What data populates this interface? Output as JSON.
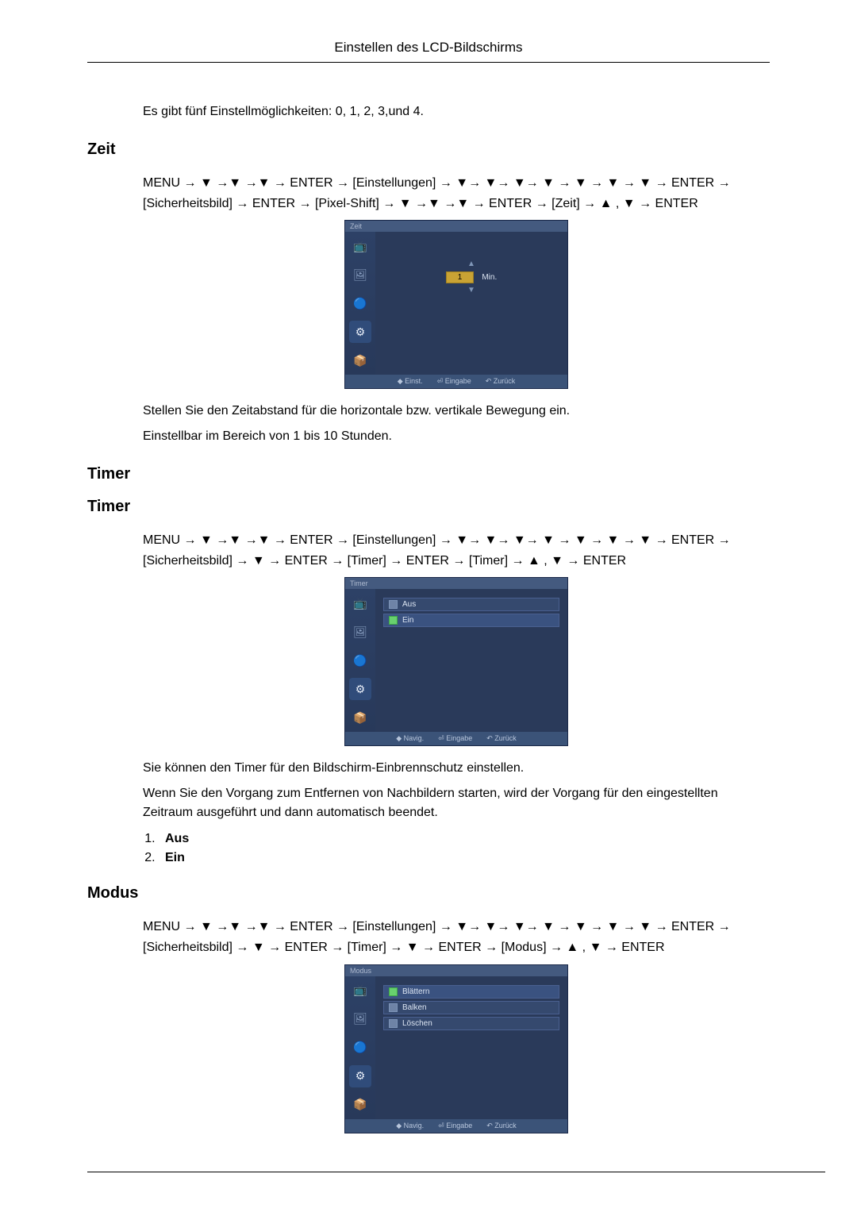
{
  "header": {
    "title": "Einstellen des LCD-Bildschirms"
  },
  "intro": "Es gibt fünf Einstellmöglichkeiten: 0, 1, 2, 3,und 4.",
  "sections": {
    "zeit": {
      "heading": "Zeit",
      "path": "MENU → ▼ →▼ →▼ → ENTER → [Einstellungen] → ▼→ ▼→ ▼→ ▼ → ▼ → ▼ → ▼ → ENTER → [Sicherheitsbild] → ENTER → [Pixel-Shift] → ▼ →▼ →▼ → ENTER → [Zeit] → ▲ , ▼ → ENTER",
      "osd_title": "Zeit",
      "osd_value": "1",
      "osd_unit": "Min.",
      "footer": {
        "a": "◆ Einst.",
        "b": "⏎ Eingabe",
        "c": "↶ Zurück"
      },
      "text1": "Stellen Sie den Zeitabstand für die horizontale bzw. vertikale Bewegung ein.",
      "text2": "Einstellbar im Bereich von 1 bis 10 Stunden."
    },
    "timer": {
      "heading1": "Timer",
      "heading2": "Timer",
      "path": "MENU → ▼ →▼ →▼ → ENTER → [Einstellungen] → ▼→ ▼→ ▼→ ▼ → ▼ → ▼ → ▼ → ENTER → [Sicherheitsbild] → ▼ → ENTER → [Timer] → ENTER → [Timer] → ▲ , ▼ → ENTER",
      "osd_title": "Timer",
      "options": {
        "off": "Aus",
        "on": "Ein"
      },
      "footer": {
        "a": "◆ Navig.",
        "b": "⏎ Eingabe",
        "c": "↶ Zurück"
      },
      "text1": "Sie können den Timer für den Bildschirm-Einbrennschutz einstellen.",
      "text2": "Wenn Sie den Vorgang zum Entfernen von Nachbildern starten, wird der Vorgang für den eingestellten Zeitraum ausgeführt und dann automatisch beendet.",
      "list": {
        "1": "Aus",
        "2": "Ein"
      }
    },
    "modus": {
      "heading": "Modus",
      "path": "MENU → ▼ →▼ →▼ → ENTER → [Einstellungen] → ▼→ ▼→ ▼→ ▼ → ▼ → ▼ → ▼ → ENTER → [Sicherheitsbild] → ▼ → ENTER → [Timer] → ▼ → ENTER → [Modus] → ▲ , ▼ → ENTER",
      "osd_title": "Modus",
      "options": {
        "a": "Blättern",
        "b": "Balken",
        "c": "Löschen"
      },
      "footer": {
        "a": "◆ Navig.",
        "b": "⏎ Eingabe",
        "c": "↶ Zurück"
      }
    }
  },
  "icons": {
    "i1": "📺",
    "i2": "🖼",
    "i3": "🔵",
    "i4": "⚙",
    "i5": "📦"
  }
}
